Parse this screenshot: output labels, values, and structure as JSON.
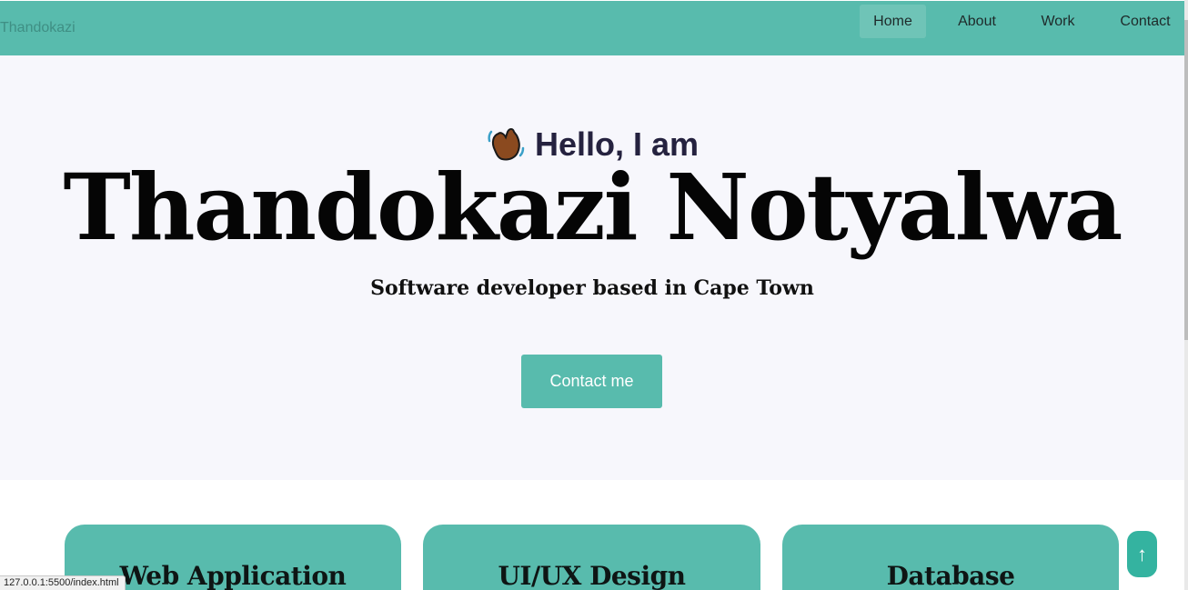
{
  "nav": {
    "brand": "Thandokazi",
    "links": [
      {
        "label": "Home",
        "active": true
      },
      {
        "label": "About",
        "active": false
      },
      {
        "label": "Work",
        "active": false
      },
      {
        "label": "Contact",
        "active": false
      }
    ]
  },
  "hero": {
    "icon": "waving-hand-icon",
    "greeting": "Hello, I am",
    "name": "Thandokazi Notyalwa",
    "subtitle": "Software developer based in Cape Town",
    "cta_label": "Contact me"
  },
  "services": [
    {
      "title": "Web Application"
    },
    {
      "title": "UI/UX Design"
    },
    {
      "title": "Database"
    }
  ],
  "scroll_top": {
    "label": "↑"
  },
  "status_bar": {
    "url": "127.0.0.1:5500/index.html"
  },
  "colors": {
    "accent": "#58bbad",
    "hero_bg": "#f7f7fc",
    "greeting_text": "#25223f"
  }
}
